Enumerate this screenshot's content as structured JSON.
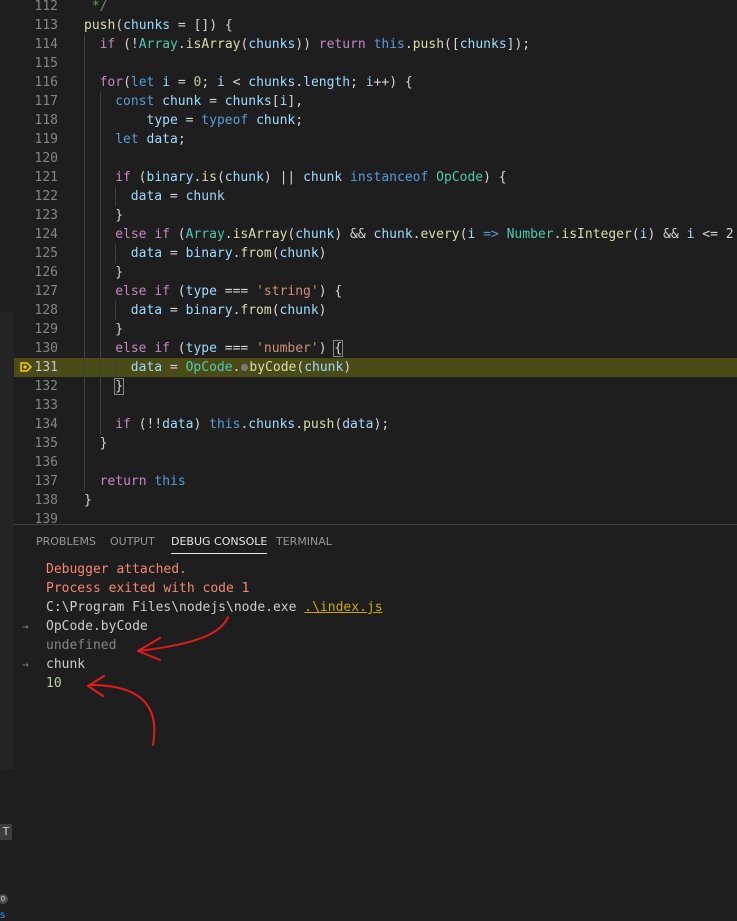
{
  "editor": {
    "lines": [
      {
        "n": "112",
        "indent": 1,
        "tokens": [
          [
            "t-cmt",
            " */"
          ]
        ]
      },
      {
        "n": "113",
        "indent": 1,
        "tokens": [
          [
            "t-fn",
            "push"
          ],
          [
            "",
            "("
          ],
          [
            "t-var",
            "chunks"
          ],
          [
            "",
            " = []) {"
          ]
        ]
      },
      {
        "n": "114",
        "indent": 2,
        "tokens": [
          [
            "t-ctrl",
            "if"
          ],
          [
            "",
            " (!"
          ],
          [
            "t-cls",
            "Array"
          ],
          [
            "",
            "."
          ],
          [
            "t-fn",
            "isArray"
          ],
          [
            "",
            "("
          ],
          [
            "t-var",
            "chunks"
          ],
          [
            "",
            ")) "
          ],
          [
            "t-ctrl",
            "return"
          ],
          [
            "",
            " "
          ],
          [
            "t-kw",
            "this"
          ],
          [
            "",
            "."
          ],
          [
            "t-fn",
            "push"
          ],
          [
            "",
            "(["
          ],
          [
            "t-var",
            "chunks"
          ],
          [
            "",
            "]);"
          ]
        ]
      },
      {
        "n": "115",
        "indent": 2,
        "tokens": []
      },
      {
        "n": "116",
        "indent": 2,
        "tokens": [
          [
            "t-ctrl",
            "for"
          ],
          [
            "",
            "("
          ],
          [
            "t-kw",
            "let"
          ],
          [
            "",
            " "
          ],
          [
            "t-var",
            "i"
          ],
          [
            "",
            " = "
          ],
          [
            "t-num",
            "0"
          ],
          [
            "",
            "; "
          ],
          [
            "t-var",
            "i"
          ],
          [
            "",
            " < "
          ],
          [
            "t-var",
            "chunks"
          ],
          [
            "",
            "."
          ],
          [
            "t-var",
            "length"
          ],
          [
            "",
            "; "
          ],
          [
            "t-var",
            "i"
          ],
          [
            "",
            "++) {"
          ]
        ]
      },
      {
        "n": "117",
        "indent": 3,
        "tokens": [
          [
            "t-kw",
            "const"
          ],
          [
            "",
            " "
          ],
          [
            "t-var",
            "chunk"
          ],
          [
            "",
            " = "
          ],
          [
            "t-var",
            "chunks"
          ],
          [
            "",
            "["
          ],
          [
            "t-var",
            "i"
          ],
          [
            "",
            "],"
          ]
        ]
      },
      {
        "n": "118",
        "indent": 3,
        "tokens": [
          [
            "",
            "    "
          ],
          [
            "t-var",
            "type"
          ],
          [
            "",
            " = "
          ],
          [
            "t-kw",
            "typeof"
          ],
          [
            "",
            " "
          ],
          [
            "t-var",
            "chunk"
          ],
          [
            "",
            ";"
          ]
        ]
      },
      {
        "n": "119",
        "indent": 3,
        "tokens": [
          [
            "t-kw",
            "let"
          ],
          [
            "",
            " "
          ],
          [
            "t-var",
            "data"
          ],
          [
            "",
            ";"
          ]
        ]
      },
      {
        "n": "120",
        "indent": 3,
        "tokens": []
      },
      {
        "n": "121",
        "indent": 3,
        "tokens": [
          [
            "t-ctrl",
            "if"
          ],
          [
            "",
            " ("
          ],
          [
            "t-var",
            "binary"
          ],
          [
            "",
            "."
          ],
          [
            "t-fn",
            "is"
          ],
          [
            "",
            "("
          ],
          [
            "t-var",
            "chunk"
          ],
          [
            "",
            ") || "
          ],
          [
            "t-var",
            "chunk"
          ],
          [
            "",
            " "
          ],
          [
            "t-kw",
            "instanceof"
          ],
          [
            "",
            " "
          ],
          [
            "t-cls",
            "OpCode"
          ],
          [
            "",
            ") {"
          ]
        ]
      },
      {
        "n": "122",
        "indent": 4,
        "tokens": [
          [
            "t-var",
            "data"
          ],
          [
            "",
            " = "
          ],
          [
            "t-var",
            "chunk"
          ]
        ]
      },
      {
        "n": "123",
        "indent": 3,
        "tokens": [
          [
            "",
            "}"
          ]
        ]
      },
      {
        "n": "124",
        "indent": 3,
        "tokens": [
          [
            "t-ctrl",
            "else"
          ],
          [
            "",
            " "
          ],
          [
            "t-ctrl",
            "if"
          ],
          [
            "",
            " ("
          ],
          [
            "t-cls",
            "Array"
          ],
          [
            "",
            "."
          ],
          [
            "t-fn",
            "isArray"
          ],
          [
            "",
            "("
          ],
          [
            "t-var",
            "chunk"
          ],
          [
            "",
            ") && "
          ],
          [
            "t-var",
            "chunk"
          ],
          [
            "",
            "."
          ],
          [
            "t-fn",
            "every"
          ],
          [
            "",
            "("
          ],
          [
            "t-var",
            "i"
          ],
          [
            "",
            " "
          ],
          [
            "t-kw",
            "=>"
          ],
          [
            "",
            " "
          ],
          [
            "t-cls",
            "Number"
          ],
          [
            "",
            "."
          ],
          [
            "t-fn",
            "isInteger"
          ],
          [
            "",
            "("
          ],
          [
            "t-var",
            "i"
          ],
          [
            "",
            ") && "
          ],
          [
            "t-var",
            "i"
          ],
          [
            "",
            " <= 2"
          ]
        ]
      },
      {
        "n": "125",
        "indent": 4,
        "tokens": [
          [
            "t-var",
            "data"
          ],
          [
            "",
            " = "
          ],
          [
            "t-var",
            "binary"
          ],
          [
            "",
            "."
          ],
          [
            "t-fn",
            "from"
          ],
          [
            "",
            "("
          ],
          [
            "t-var",
            "chunk"
          ],
          [
            "",
            ")"
          ]
        ]
      },
      {
        "n": "126",
        "indent": 3,
        "tokens": [
          [
            "",
            "}"
          ]
        ]
      },
      {
        "n": "127",
        "indent": 3,
        "tokens": [
          [
            "t-ctrl",
            "else"
          ],
          [
            "",
            " "
          ],
          [
            "t-ctrl",
            "if"
          ],
          [
            "",
            " ("
          ],
          [
            "t-var",
            "type"
          ],
          [
            "",
            " === "
          ],
          [
            "t-str",
            "'string'"
          ],
          [
            "",
            ") {"
          ]
        ]
      },
      {
        "n": "128",
        "indent": 4,
        "tokens": [
          [
            "t-var",
            "data"
          ],
          [
            "",
            " = "
          ],
          [
            "t-var",
            "binary"
          ],
          [
            "",
            "."
          ],
          [
            "t-fn",
            "from"
          ],
          [
            "",
            "("
          ],
          [
            "t-var",
            "chunk"
          ],
          [
            "",
            ")"
          ]
        ]
      },
      {
        "n": "129",
        "indent": 3,
        "tokens": [
          [
            "",
            "}"
          ]
        ]
      },
      {
        "n": "130",
        "indent": 3,
        "tokens": [
          [
            "t-ctrl",
            "else"
          ],
          [
            "",
            " "
          ],
          [
            "t-ctrl",
            "if"
          ],
          [
            "",
            " ("
          ],
          [
            "t-var",
            "type"
          ],
          [
            "",
            " === "
          ],
          [
            "t-str",
            "'number'"
          ],
          [
            "",
            ") "
          ],
          [
            "brace",
            "{"
          ]
        ]
      },
      {
        "n": "131",
        "indent": 4,
        "highlight": true,
        "tokens": [
          [
            "t-var",
            "data"
          ],
          [
            "",
            " = "
          ],
          [
            "t-cls",
            "OpCode"
          ],
          [
            "",
            "."
          ],
          [
            "bp",
            ""
          ],
          [
            "t-fn",
            "byCode"
          ],
          [
            "",
            "("
          ],
          [
            "t-var",
            "chunk"
          ],
          [
            "",
            ")"
          ]
        ]
      },
      {
        "n": "132",
        "indent": 3,
        "tokens": [
          [
            "brace",
            "}"
          ]
        ]
      },
      {
        "n": "133",
        "indent": 3,
        "tokens": []
      },
      {
        "n": "134",
        "indent": 3,
        "tokens": [
          [
            "t-ctrl",
            "if"
          ],
          [
            "",
            " (!!"
          ],
          [
            "t-var",
            "data"
          ],
          [
            "",
            ") "
          ],
          [
            "t-kw",
            "this"
          ],
          [
            "",
            "."
          ],
          [
            "t-var",
            "chunks"
          ],
          [
            "",
            "."
          ],
          [
            "t-fn",
            "push"
          ],
          [
            "",
            "("
          ],
          [
            "t-var",
            "data"
          ],
          [
            "",
            ");"
          ]
        ]
      },
      {
        "n": "135",
        "indent": 2,
        "tokens": [
          [
            "",
            "}"
          ]
        ]
      },
      {
        "n": "136",
        "indent": 2,
        "tokens": []
      },
      {
        "n": "137",
        "indent": 2,
        "tokens": [
          [
            "t-ctrl",
            "return"
          ],
          [
            "",
            " "
          ],
          [
            "t-kw",
            "this"
          ]
        ]
      },
      {
        "n": "138",
        "indent": 1,
        "tokens": [
          [
            "",
            "}"
          ]
        ]
      },
      {
        "n": "139",
        "indent": 1,
        "tokens": []
      }
    ]
  },
  "panel": {
    "tabs": [
      {
        "label": "PROBLEMS",
        "active": false
      },
      {
        "label": "OUTPUT",
        "active": false
      },
      {
        "label": "DEBUG CONSOLE",
        "active": true
      },
      {
        "label": "TERMINAL",
        "active": false
      }
    ],
    "console": [
      {
        "text": "Debugger attached.",
        "style": "c-red",
        "arrow": false
      },
      {
        "text": "Process exited with code 1",
        "style": "c-red",
        "arrow": false
      },
      {
        "text": "C:\\Program Files\\nodejs\\node.exe ",
        "link": ".\\index.js",
        "style": "c-default",
        "arrow": false
      },
      {
        "text": "OpCode.byCode",
        "style": "c-default",
        "arrow": true,
        "arrow_dir": "right"
      },
      {
        "text": "undefined",
        "style": "c-gray",
        "arrow": false
      },
      {
        "text": "chunk",
        "style": "c-default",
        "arrow": true,
        "arrow_dir": "right"
      },
      {
        "text": "10",
        "style": "c-green",
        "arrow": false
      }
    ]
  },
  "sidebar": {
    "t_label": "T",
    "badge": "0",
    "s_label": "s"
  },
  "colors": {
    "annotation": "#e51b1b",
    "highlight": "#4b4b18"
  },
  "icons": {
    "breakpoint": "debug-breakpoint-arrow-icon",
    "inline_breakpoint": "inline-breakpoint-dot-icon",
    "console_input": "chevron-right-icon"
  }
}
